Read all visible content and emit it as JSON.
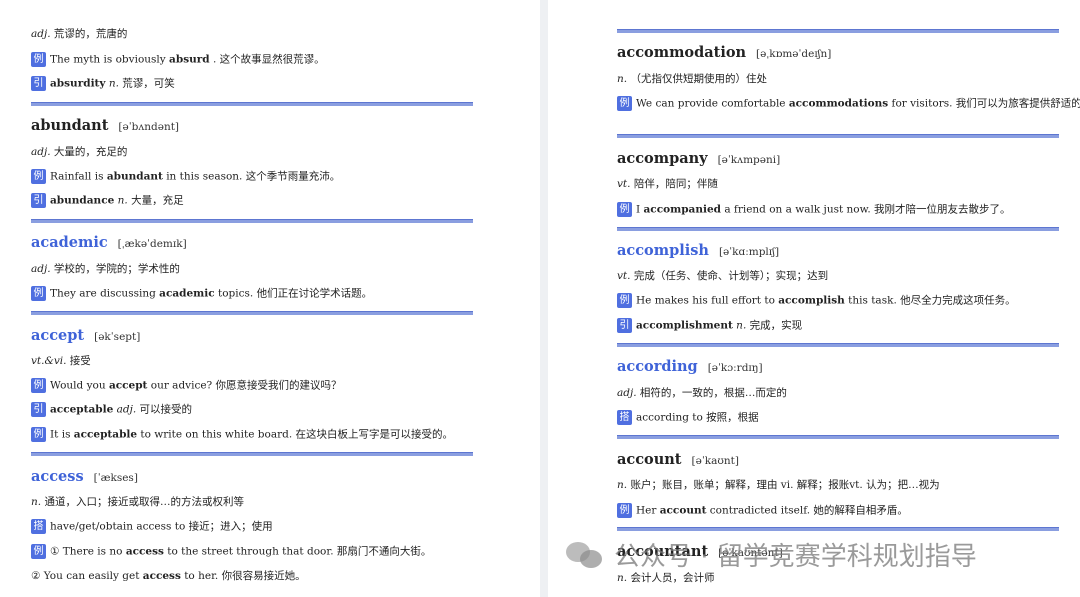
{
  "left": {
    "l1_pos": "adj.",
    "l1_cn": " 荒谬的，荒唐的",
    "l2_badge": "例",
    "l2_a": "The myth is obviously ",
    "l2_b": "absurd",
    "l2_c": " . 这个故事显然很荒谬。",
    "l3_badge": "引",
    "l3_b": "absurdity",
    "l3_pos": " n.",
    "l3_c": " 荒谬，可笑",
    "e1_word": "abundant",
    "e1_phon": "[əˈbʌndənt]",
    "e1_l1_pos": "adj.",
    "e1_l1_cn": " 大量的，充足的",
    "e1_l2_badge": "例",
    "e1_l2_a": "Rainfall is ",
    "e1_l2_b": "abundant",
    "e1_l2_c": " in this season. 这个季节雨量充沛。",
    "e1_l3_badge": "引",
    "e1_l3_b": "abundance",
    "e1_l3_pos": " n.",
    "e1_l3_c": " 大量，充足",
    "e2_word": "academic",
    "e2_phon": "[ˌækəˈdemɪk]",
    "e2_l1_pos": "adj.",
    "e2_l1_cn": " 学校的，学院的；学术性的",
    "e2_l2_badge": "例",
    "e2_l2_a": "They are discussing ",
    "e2_l2_b": "academic",
    "e2_l2_c": " topics. 他们正在讨论学术话题。",
    "e3_word": "accept",
    "e3_phon": "[əkˈsept]",
    "e3_l1_pos": "vt.&vi.",
    "e3_l1_cn": " 接受",
    "e3_l2_badge": "例",
    "e3_l2_a": "Would you ",
    "e3_l2_b": "accept",
    "e3_l2_c": " our advice? 你愿意接受我们的建议吗？",
    "e3_l3_badge": "引",
    "e3_l3_b": "acceptable",
    "e3_l3_pos": " adj.",
    "e3_l3_c": " 可以接受的",
    "e3_l4_badge": "例",
    "e3_l4_a": "It is ",
    "e3_l4_b": "acceptable",
    "e3_l4_c": " to write on this white board. 在这块白板上写字是可以接受的。",
    "e4_word": "access",
    "e4_phon": "[ˈækses]",
    "e4_l1_pos": "n.",
    "e4_l1_cn": " 通道，入口；接近或取得…的方法或权利等",
    "e4_l2_badge": "搭",
    "e4_l2_a": "have/get/obtain access to 接近；进入；使用",
    "e4_l3_badge": "例",
    "e4_l3_a": "① There is no ",
    "e4_l3_b": "access",
    "e4_l3_c": " to the street through that door. 那扇门不通向大街。",
    "e4_l4_a": "② You can easily get ",
    "e4_l4_b": "access",
    "e4_l4_c": " to her. 你很容易接近她。"
  },
  "right": {
    "e1_word": "accommodation",
    "e1_phon": "[əˌkɒməˈdeɪʃn]",
    "e1_l1_pos": "n.",
    "e1_l1_cn": " （尤指仅供短期使用的）住处",
    "e1_l2_badge": "例",
    "e1_l2_a": "We can provide comfortable ",
    "e1_l2_b": "accommodations",
    "e1_l2_c": " for visitors. 我们可以为旅客提供舒适的住",
    "e2_word": "accompany",
    "e2_phon": "[əˈkʌmpəni]",
    "e2_l1_pos": "vt.",
    "e2_l1_cn": " 陪伴，陪同；伴随",
    "e2_l2_badge": "例",
    "e2_l2_a": "I ",
    "e2_l2_b": "accompanied",
    "e2_l2_c": " a friend on a walk just now. 我刚才陪一位朋友去散步了。",
    "e3_word": "accomplish",
    "e3_phon": "[əˈkɑːmplɪʃ]",
    "e3_l1_pos": "vt.",
    "e3_l1_cn": " 完成（任务、使命、计划等）；实现；达到",
    "e3_l2_badge": "例",
    "e3_l2_a": "He makes his full effort to ",
    "e3_l2_b": "accomplish",
    "e3_l2_c": " this task. 他尽全力完成这项任务。",
    "e3_l3_badge": "引",
    "e3_l3_b": "accomplishment",
    "e3_l3_pos": " n.",
    "e3_l3_c": " 完成，实现",
    "e4_word": "according",
    "e4_phon": "[əˈkɔːrdɪŋ]",
    "e4_l1_pos": "adj.",
    "e4_l1_cn": " 相符的，一致的，根据…而定的",
    "e4_l2_badge": "搭",
    "e4_l2_a": "according to 按照，根据",
    "e5_word": "account",
    "e5_phon": "[əˈkaʊnt]",
    "e5_l1_pos": "n.",
    "e5_l1_cn": " 账户；账目，账单；解释，理由 vi. 解释；报账vt. 认为；把…视为",
    "e5_l2_badge": "例",
    "e5_l2_a": "Her ",
    "e5_l2_b": "account",
    "e5_l2_c": " contradicted itself. 她的解释自相矛盾。",
    "e6_word": "accountant",
    "e6_phon": "[əˈkaʊntənt]",
    "e6_l1_pos": "n.",
    "e6_l1_cn": " 会计人员，会计师"
  },
  "watermark": {
    "text": "公众号 · 留学竞赛学科规划指导"
  }
}
